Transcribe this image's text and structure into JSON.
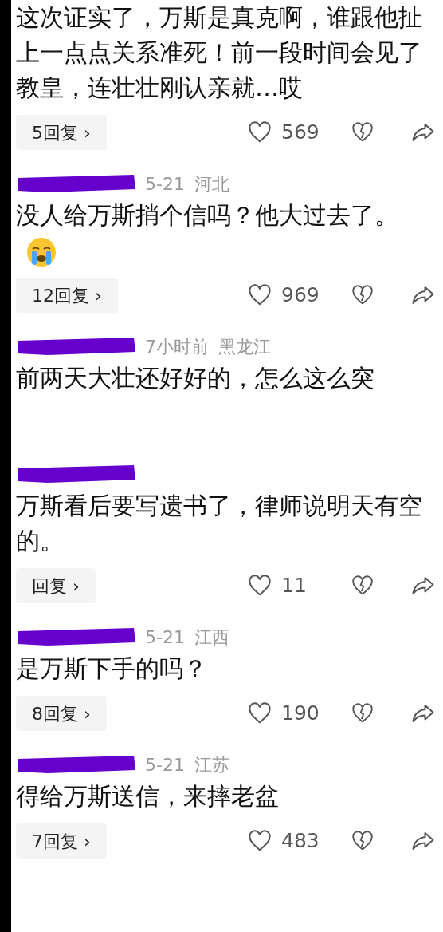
{
  "comments": [
    {
      "text": "这次证实了，万斯是真克啊，谁跟他扯上一点点关系准死！前一段时间会见了教皇，连壮壮刚认亲就…哎",
      "replies": "5回复 ›",
      "likes": "569"
    },
    {
      "author_redacted": true,
      "time": "5-21",
      "location": "河北",
      "text": "没人给万斯捎个信吗？他大过去了。",
      "emoji": true,
      "replies": "12回复 ›",
      "likes": "969"
    },
    {
      "author_redacted": true,
      "time": "7小时前",
      "location": "黑龙江",
      "text": "前两天大壮还好好的，怎么这么突"
    },
    {
      "author_redacted": true,
      "text": "万斯看后要写遗书了，律师说明天有空的。",
      "replies": "回复 ›",
      "likes": "11"
    },
    {
      "author_redacted": true,
      "time": "5-21",
      "location": "江西",
      "text": "是万斯下手的吗？",
      "replies": "8回复 ›",
      "likes": "190"
    },
    {
      "author_redacted": true,
      "time": "5-21",
      "location": "江苏",
      "text": "得给万斯送信，来摔老盆",
      "replies": "7回复 ›",
      "likes": "483"
    }
  ]
}
